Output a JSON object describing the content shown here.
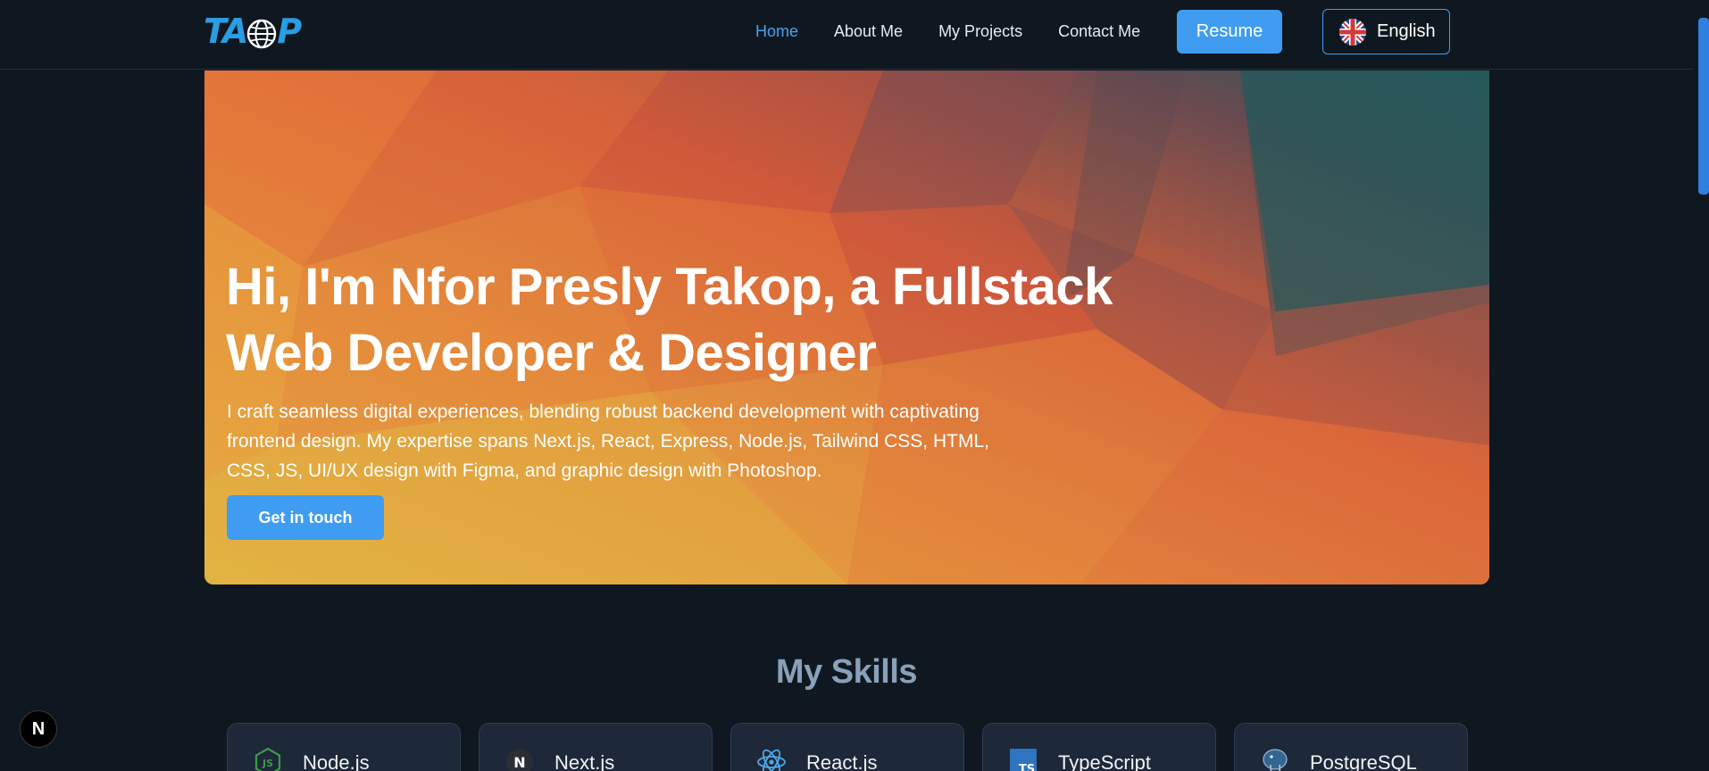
{
  "brand": {
    "logo_text_left": "TA",
    "logo_text_right": "P",
    "logo_icon": "globe-icon",
    "accent": "#3f9cf1"
  },
  "nav": {
    "links": [
      {
        "label": "Home",
        "active": true
      },
      {
        "label": "About Me",
        "active": false
      },
      {
        "label": "My Projects",
        "active": false
      },
      {
        "label": "Contact Me",
        "active": false
      }
    ],
    "resume_label": "Resume",
    "language_label": "English",
    "language_icon": "uk-flag-icon"
  },
  "hero": {
    "title_line1": "Hi, I'm Nfor Presly Takop, a Fullstack",
    "title_line2": "Web Developer & Designer",
    "description": "I craft seamless digital experiences, blending robust backend development with captivating frontend design. My expertise spans Next.js, React, Express, Node.js, Tailwind CSS, HTML, CSS, JS, UI/UX design with Figma, and graphic design with Photoshop.",
    "cta_label": "Get in touch"
  },
  "skills": {
    "title": "My Skills",
    "items": [
      {
        "name": "Node.js",
        "icon": "nodejs-icon"
      },
      {
        "name": "Next.js",
        "icon": "nextjs-icon"
      },
      {
        "name": "React.js",
        "icon": "react-icon"
      },
      {
        "name": "TypeScript",
        "icon": "typescript-icon"
      },
      {
        "name": "PostgreSQL",
        "icon": "postgresql-icon"
      }
    ]
  },
  "badge": {
    "label": "N",
    "icon": "nextjs-dev-indicator-icon"
  }
}
